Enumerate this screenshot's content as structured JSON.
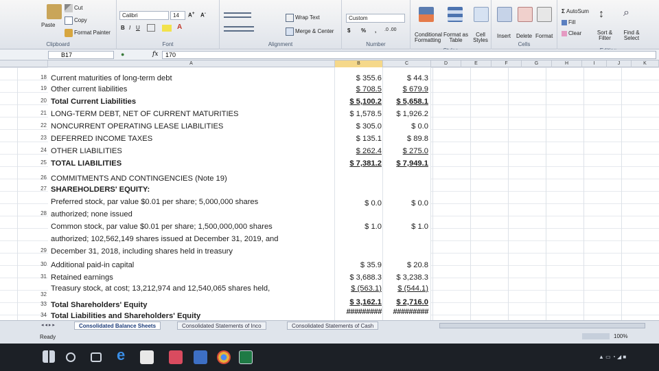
{
  "ribbon": {
    "clipboard": {
      "paste": "Paste",
      "cut": "Cut",
      "copy": "Copy",
      "format_painter": "Format Painter",
      "label": "Clipboard"
    },
    "font": {
      "name": "Calibri",
      "size": "14",
      "label": "Font"
    },
    "alignment": {
      "wrap_text": "Wrap Text",
      "merge_center": "Merge & Center",
      "label": "Alignment"
    },
    "number": {
      "format": "Custom",
      "label": "Number"
    },
    "styles": {
      "conditional": "Conditional Formatting",
      "format_table": "Format as Table",
      "cell_styles": "Cell Styles",
      "label": "Styles"
    },
    "cells": {
      "insert": "Insert",
      "delete": "Delete",
      "format": "Format",
      "label": "Cells"
    },
    "editing": {
      "autosum": "AutoSum",
      "fill": "Fill",
      "clear": "Clear",
      "sort_filter": "Sort & Filter",
      "find_select": "Find & Select",
      "label": "Editing"
    }
  },
  "formula_bar": {
    "cell_ref": "B17",
    "fx": "fx",
    "content": "170"
  },
  "columns": [
    "A",
    "B",
    "C",
    "D",
    "E",
    "F",
    "G",
    "H",
    "I",
    "J",
    "K"
  ],
  "rows": [
    {
      "num": "18",
      "label": "Current maturities of long-term debt",
      "b": "$ 355.6",
      "c": "$ 44.3"
    },
    {
      "num": "19",
      "label": "Other current liabilities",
      "b": "$ 708.5",
      "c": "$ 679.9"
    },
    {
      "num": "20",
      "label": "Total Current Liabilities",
      "b": "$ 5,100.2",
      "c": "$ 5,658.1"
    },
    {
      "num": "21",
      "label": "LONG-TERM DEBT, NET OF CURRENT MATURITIES",
      "b": "$ 1,578.5",
      "c": "$ 1,926.2"
    },
    {
      "num": "22",
      "label": "NONCURRENT OPERATING LEASE LIABILITIES",
      "b": "$ 305.0",
      "c": "$ 0.0"
    },
    {
      "num": "23",
      "label": "DEFERRED INCOME TAXES",
      "b": "$ 135.1",
      "c": "$ 89.8"
    },
    {
      "num": "24",
      "label": "OTHER LIABILITIES",
      "b": "$ 262.4",
      "c": "$ 275.0"
    },
    {
      "num": "25",
      "label": "TOTAL LIABILITIES",
      "b": "$ 7,381.2",
      "c": "$ 7,949.1"
    },
    {
      "num": "26",
      "label": "COMMITMENTS AND CONTINGENCIES (Note 19)",
      "b": "",
      "c": ""
    },
    {
      "num": "27",
      "label": "SHAREHOLDERS' EQUITY:",
      "b": "",
      "c": ""
    },
    {
      "num": "28",
      "label_lines": [
        "Preferred stock, par value $0.01 per share; 5,000,000 shares",
        "authorized; none issued"
      ],
      "b": "$ 0.0",
      "c": "$ 0.0"
    },
    {
      "num": "29",
      "label_lines": [
        "Common stock, par value $0.01 per share; 1,500,000,000 shares",
        "authorized; 102,562,149 shares issued at December 31, 2019, and",
        "December 31, 2018, including shares held in treasury"
      ],
      "b": "$ 1.0",
      "c": "$ 1.0"
    },
    {
      "num": "30",
      "label": "Additional paid-in capital",
      "b": "$ 35.9",
      "c": "$ 20.8"
    },
    {
      "num": "31",
      "label": "Retained earnings",
      "b": "$ 3,688.3",
      "c": "$ 3,238.3"
    },
    {
      "num": "32",
      "label": "Treasury stock, at cost; 13,212,974 and 12,540,065 shares held,",
      "b": "$ (563.1)",
      "c": "$ (544.1)"
    },
    {
      "num": "33",
      "label": "Total Shareholders' Equity",
      "b": "$ 3,162.1",
      "c": "$ 2,716.0"
    },
    {
      "num": "34",
      "label": "Total Liabilities and Shareholders' Equity",
      "b": "#########",
      "c": "#########"
    }
  ],
  "sheet_tabs": [
    "Consolidated Balance Sheets",
    "Consolidated Statements of Inco",
    "Consolidated Statements of Cash"
  ],
  "status": {
    "ready": "Ready",
    "zoom": "100%"
  },
  "colors": {
    "accent": "#1c3c7a",
    "ribbon": "#dfe3ea",
    "taskbar": "#1c2026"
  }
}
